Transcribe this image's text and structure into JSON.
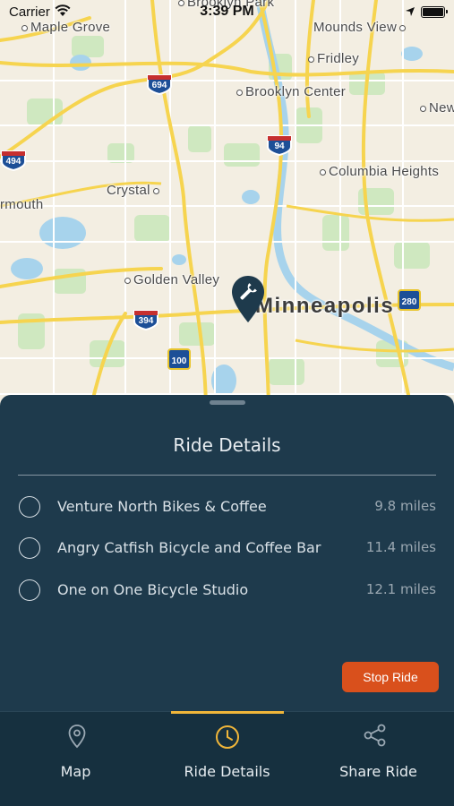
{
  "status_bar": {
    "carrier": "Carrier",
    "time": "3:39 PM"
  },
  "map": {
    "labels": {
      "brooklyn_park": "Brooklyn Park",
      "maple_grove": "Maple Grove",
      "mounds_view": "Mounds View",
      "fridley": "Fridley",
      "brooklyn_center": "Brooklyn Center",
      "new": "New",
      "columbia_heights": "Columbia Heights",
      "crystal": "Crystal",
      "plymouth": "rmouth",
      "golden_valley": "Golden Valley",
      "minneapolis": "Minneapolis"
    },
    "shields": {
      "i694": "694",
      "i494": "494",
      "i94": "94",
      "i394": "394",
      "r280": "280",
      "r100": "100"
    },
    "pin_icon": "wrench-icon"
  },
  "panel": {
    "title": "Ride Details",
    "shops": [
      {
        "name": "Venture North Bikes & Coffee",
        "distance": "9.8 miles"
      },
      {
        "name": "Angry Catfish Bicycle and Coffee Bar",
        "distance": "11.4 miles"
      },
      {
        "name": "One on One Bicycle Studio",
        "distance": "12.1 miles"
      }
    ],
    "stop_button": "Stop Ride",
    "accent_color": "#d9501c",
    "background_color": "#1e3a4c"
  },
  "tabs": [
    {
      "label": "Map",
      "icon": "map-pin-icon"
    },
    {
      "label": "Ride Details",
      "icon": "clock-icon",
      "active": true
    },
    {
      "label": "Share Ride",
      "icon": "share-icon"
    }
  ]
}
